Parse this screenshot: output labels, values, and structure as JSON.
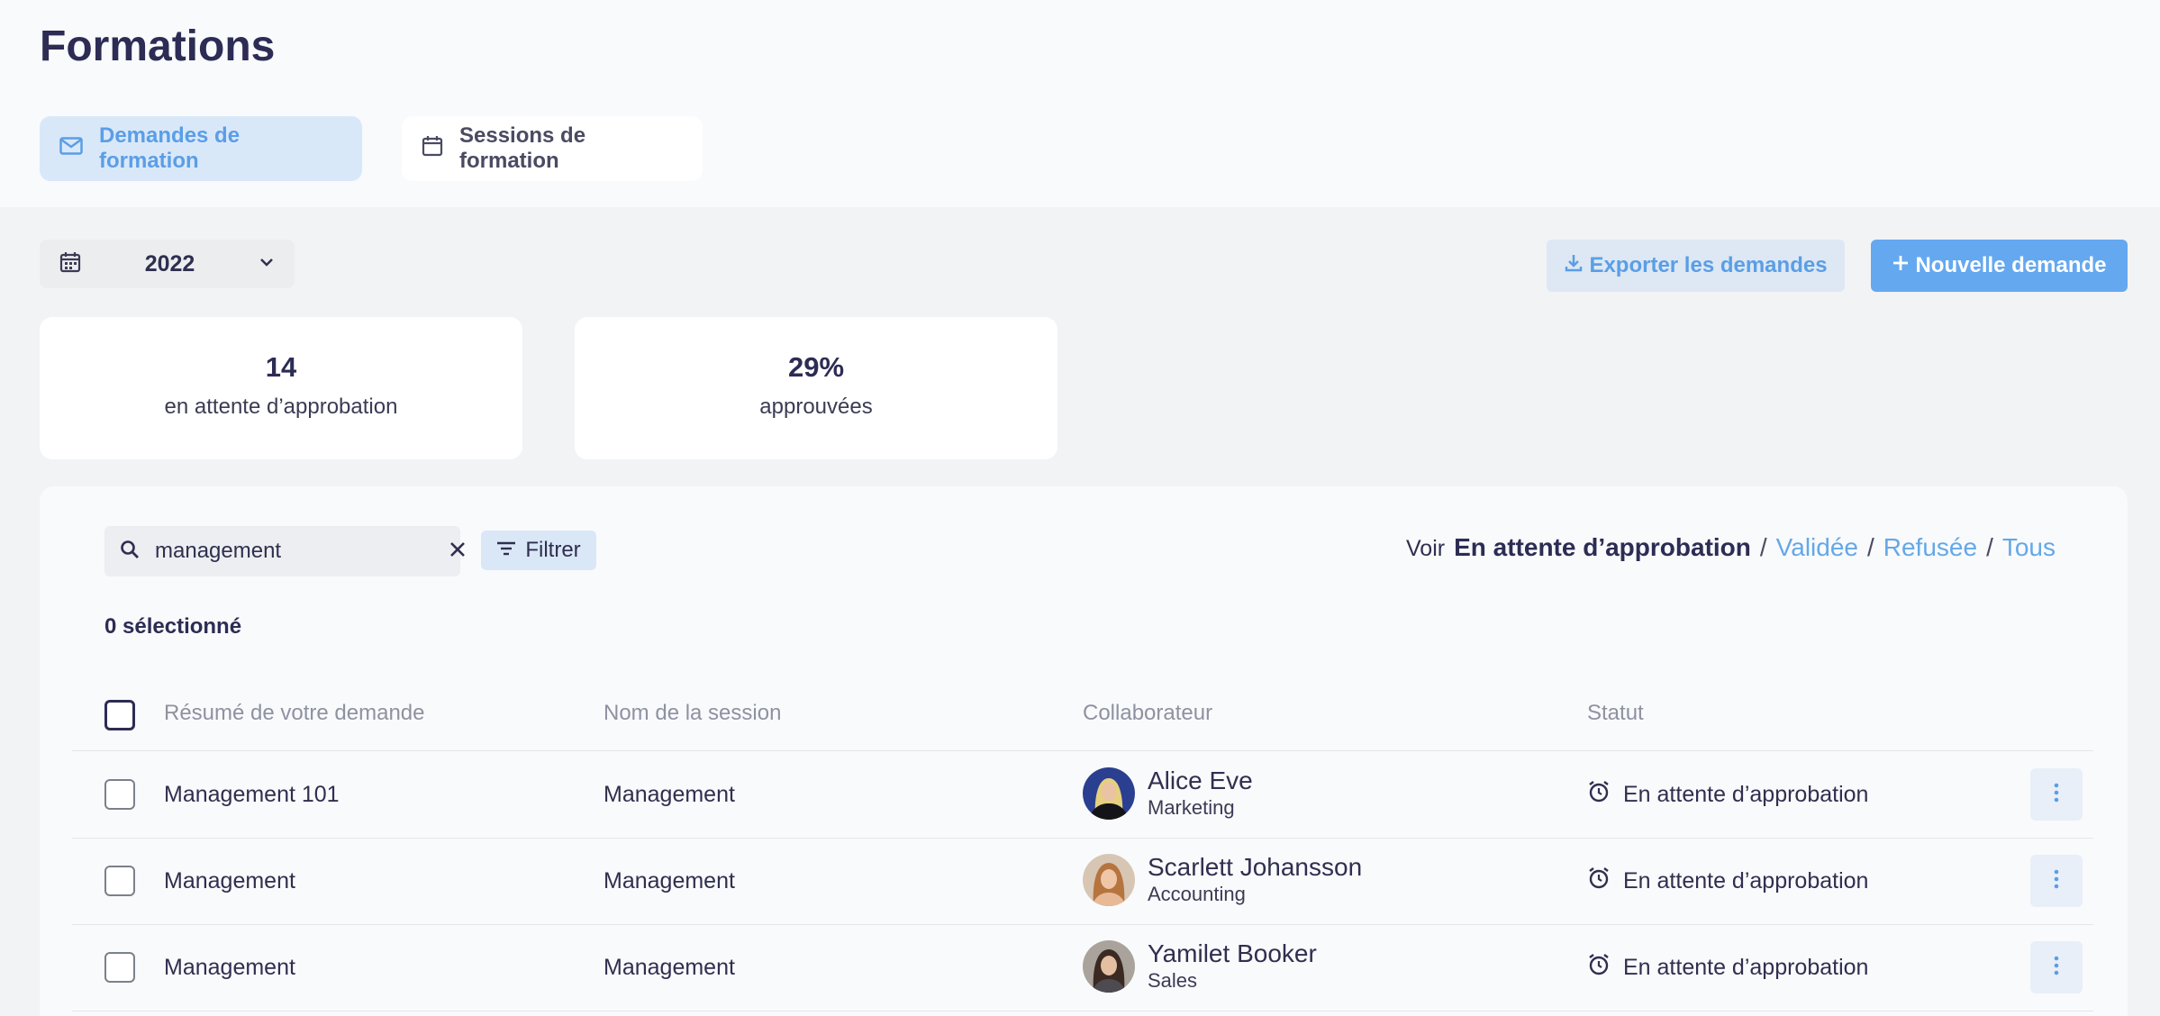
{
  "page": {
    "title": "Formations"
  },
  "tabs": [
    {
      "label": "Demandes de formation",
      "icon": "mail-icon",
      "active": true
    },
    {
      "label": "Sessions de formation",
      "icon": "calendar-icon",
      "active": false
    }
  ],
  "toolbar": {
    "year": "2022",
    "export_label": "Exporter les demandes",
    "new_label": "Nouvelle demande"
  },
  "stats": [
    {
      "value": "14",
      "label": "en attente d’approbation"
    },
    {
      "value": "29%",
      "label": "approuvées"
    }
  ],
  "search": {
    "value": "management"
  },
  "filter": {
    "label": "Filtrer"
  },
  "view": {
    "label": "Voir",
    "options": [
      "En attente d’approbation",
      "Validée",
      "Refusée",
      "Tous"
    ],
    "separator": "/",
    "active": "En attente d’approbation"
  },
  "selection": {
    "text": "0 sélectionné"
  },
  "table": {
    "columns": [
      "Résumé de votre demande",
      "Nom de la session",
      "Collaborateur",
      "Statut"
    ],
    "rows": [
      {
        "summary": "Management 101",
        "session": "Management",
        "name": "Alice Eve",
        "department": "Marketing",
        "status": "En attente d’approbation"
      },
      {
        "summary": "Management",
        "session": "Management",
        "name": "Scarlett Johansson",
        "department": "Accounting",
        "status": "En attente d’approbation"
      },
      {
        "summary": "Management",
        "session": "Management",
        "name": "Yamilet Booker",
        "department": "Sales",
        "status": "En attente d’approbation"
      }
    ]
  },
  "colors": {
    "accent": "#64a8f0",
    "accent_light": "#d9e8f9",
    "text_dark": "#2c2c54",
    "muted": "#8e92a0"
  }
}
